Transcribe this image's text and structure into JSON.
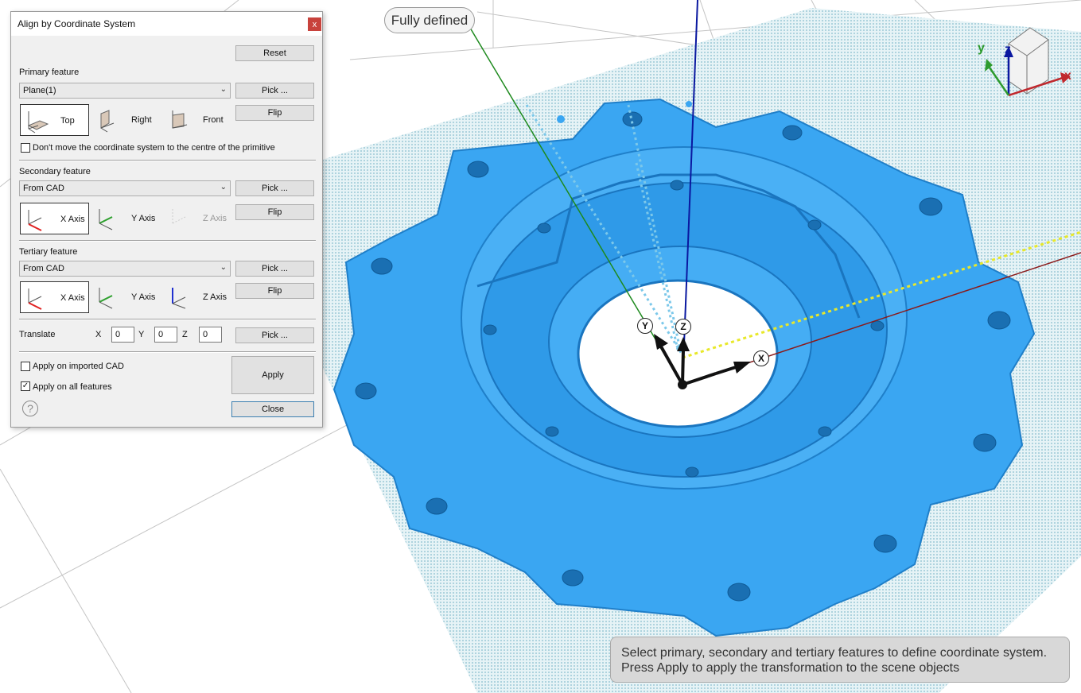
{
  "viewport": {
    "status": "Fully defined",
    "hint_line1": "Select primary, secondary and tertiary features to define coordinate system.",
    "hint_line2": "Press Apply to apply the transformation to the scene objects",
    "axis_labels": {
      "x": "X",
      "y": "Y",
      "z": "Z"
    },
    "gizmo": {
      "x": "x",
      "y": "y",
      "z": "z"
    },
    "colors": {
      "part": "#3aa6f2",
      "x_axis": "#8b1a1a",
      "y_axis": "#1e8a1e",
      "z_axis": "#0a18a0",
      "yellow_axis": "#e8e82a",
      "plane": "#b8dde6"
    }
  },
  "dialog": {
    "title": "Align by Coordinate System",
    "close_glyph": "x",
    "reset": "Reset",
    "primary": {
      "label": "Primary feature",
      "select": "Plane(1)",
      "pick": "Pick ...",
      "flip": "Flip",
      "options": [
        "Top",
        "Right",
        "Front"
      ],
      "dont_move": "Don't move the coordinate system to the centre of the primitive"
    },
    "secondary": {
      "label": "Secondary feature",
      "select": "From CAD",
      "pick": "Pick ...",
      "flip": "Flip",
      "options": [
        "X Axis",
        "Y Axis",
        "Z Axis"
      ]
    },
    "tertiary": {
      "label": "Tertiary feature",
      "select": "From CAD",
      "pick": "Pick ...",
      "flip": "Flip",
      "options": [
        "X Axis",
        "Y Axis",
        "Z Axis"
      ]
    },
    "translate": {
      "label": "Translate",
      "x_label": "X",
      "x": "0",
      "y_label": "Y",
      "y": "0",
      "z_label": "Z",
      "z": "0",
      "pick": "Pick ..."
    },
    "apply_imported_cad": "Apply on imported CAD",
    "apply_all_features": "Apply on all features",
    "apply_all_checked": true,
    "apply": "Apply",
    "close": "Close",
    "help_glyph": "?"
  }
}
